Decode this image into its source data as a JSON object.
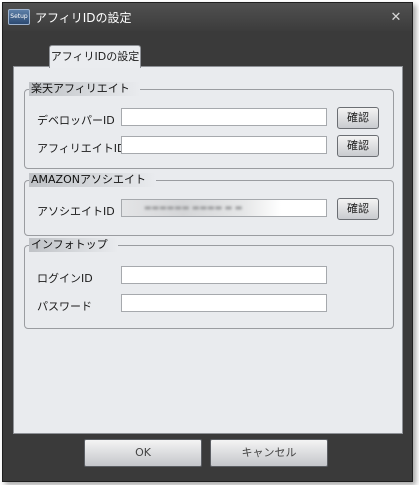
{
  "window": {
    "title": "アフィリIDの設定",
    "icon": "app-icon",
    "icon_text": "Setup"
  },
  "tab": {
    "label": "アフィリIDの設定"
  },
  "rakuten": {
    "title": "楽天アフィリエイト",
    "developer_label": "デベロッパーID",
    "developer_value": "",
    "affiliate_label": "アフィリエイトID",
    "affiliate_value": "",
    "confirm_label": "確認"
  },
  "amazon": {
    "title": "AMAZONアソシエイト",
    "associate_label": "アソシエイトID",
    "confirm_label": "確認"
  },
  "infotop": {
    "title": "インフォトップ",
    "login_label": "ログインID",
    "login_value": "",
    "password_label": "パスワード",
    "password_value": ""
  },
  "footer": {
    "ok_label": "OK",
    "cancel_label": "キャンセル"
  },
  "colors": {
    "titlebar": "#3c3c3c",
    "panel": "#e9ebee",
    "border": "#8e9196"
  }
}
